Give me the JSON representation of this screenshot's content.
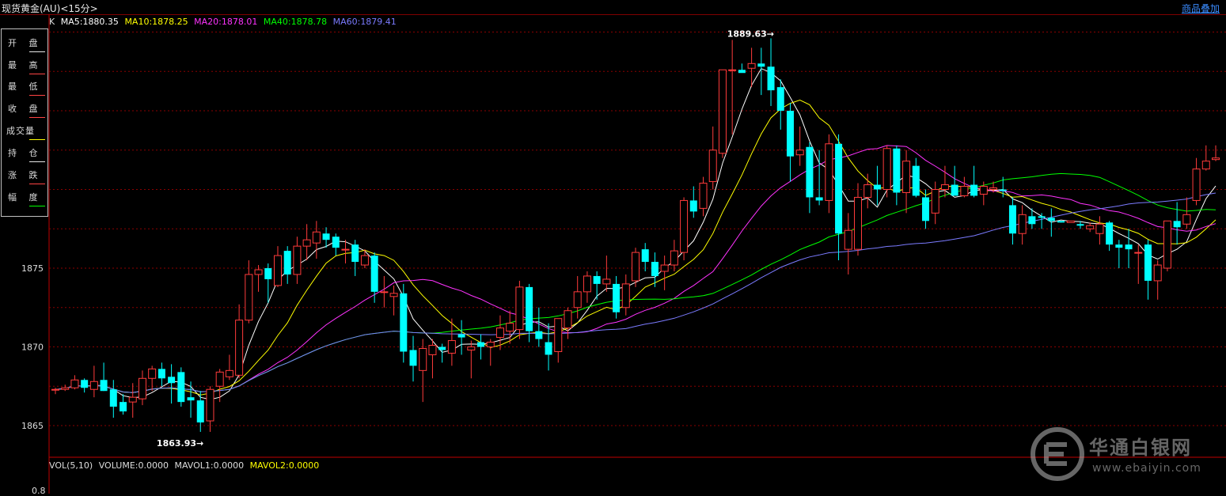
{
  "header": {
    "title": "现货黄金(AU)<15分>",
    "overlay_link": "商品叠加"
  },
  "ma_legend": {
    "prefix": "K",
    "items": [
      {
        "label": "MA5:1880.35",
        "color": "#ffffff"
      },
      {
        "label": "MA10:1878.25",
        "color": "#ffff00"
      },
      {
        "label": "MA20:1878.01",
        "color": "#ff33ff"
      },
      {
        "label": "MA40:1878.78",
        "color": "#00ff00"
      },
      {
        "label": "MA60:1879.41",
        "color": "#7b7bff"
      }
    ]
  },
  "info_panel": {
    "rows": [
      "开 盘",
      "最 高",
      "最 低",
      "收 盘",
      "成交量",
      "持 仓",
      "涨 跌",
      "幅 度"
    ]
  },
  "annotations": {
    "high": "1889.63→",
    "low": "1863.93→"
  },
  "volume_legend": {
    "items": [
      {
        "label": "VOL(5,10)",
        "color": "#dddddd"
      },
      {
        "label": "VOLUME:0.0000",
        "color": "#dddddd"
      },
      {
        "label": "MAVOL1:0.0000",
        "color": "#dddddd"
      },
      {
        "label": "MAVOL2:0.0000",
        "color": "#ffff00"
      }
    ],
    "tick": "0.8"
  },
  "watermark": {
    "text": "华通白银网",
    "url": "www.ebaiyin.com"
  },
  "colors": {
    "up": "#ff3b3b",
    "down": "#00ffff",
    "grid": "#8b0000"
  },
  "chart_data": {
    "type": "candlestick",
    "title": "",
    "ylim": [
      1862,
      1892
    ],
    "yticks": [
      1865,
      1870,
      1875
    ],
    "candles": [
      [
        1867.3,
        1867.4,
        1867.0,
        1867.3
      ],
      [
        1867.3,
        1867.6,
        1867.2,
        1867.4
      ],
      [
        1867.4,
        1868.2,
        1867.3,
        1867.9
      ],
      [
        1867.9,
        1868.0,
        1867.1,
        1867.4
      ],
      [
        1867.3,
        1868.8,
        1866.8,
        1867.8
      ],
      [
        1867.9,
        1869.0,
        1867.2,
        1867.2
      ],
      [
        1867.3,
        1867.9,
        1865.5,
        1866.2
      ],
      [
        1866.5,
        1867.0,
        1865.7,
        1865.9
      ],
      [
        1866.5,
        1867.7,
        1865.5,
        1866.8
      ],
      [
        1866.7,
        1868.5,
        1866.3,
        1868.0
      ],
      [
        1868.0,
        1868.8,
        1867.2,
        1868.6
      ],
      [
        1868.6,
        1869.0,
        1867.5,
        1868.0
      ],
      [
        1868.1,
        1868.9,
        1866.4,
        1867.7
      ],
      [
        1868.4,
        1868.7,
        1866.2,
        1866.5
      ],
      [
        1866.8,
        1867.8,
        1865.5,
        1866.6
      ],
      [
        1866.6,
        1867.2,
        1864.6,
        1865.2
      ],
      [
        1865.3,
        1867.5,
        1864.6,
        1867.3
      ],
      [
        1867.5,
        1868.6,
        1866.5,
        1868.4
      ],
      [
        1868.1,
        1869.5,
        1867.9,
        1868.5
      ],
      [
        1868.2,
        1872.7,
        1868.0,
        1871.7
      ],
      [
        1871.7,
        1875.5,
        1871.5,
        1874.6
      ],
      [
        1874.6,
        1875.2,
        1873.5,
        1874.9
      ],
      [
        1875.0,
        1875.3,
        1872.8,
        1874.3
      ],
      [
        1873.9,
        1876.4,
        1873.8,
        1875.8
      ],
      [
        1876.1,
        1876.4,
        1874.0,
        1874.6
      ],
      [
        1874.6,
        1877.0,
        1874.0,
        1876.4
      ],
      [
        1876.4,
        1877.8,
        1875.5,
        1876.8
      ],
      [
        1876.6,
        1878.0,
        1875.6,
        1877.3
      ],
      [
        1877.2,
        1877.6,
        1876.3,
        1876.8
      ],
      [
        1877.0,
        1877.2,
        1875.8,
        1876.3
      ],
      [
        1876.2,
        1876.8,
        1875.3,
        1876.2
      ],
      [
        1876.5,
        1876.8,
        1874.5,
        1875.4
      ],
      [
        1875.2,
        1876.2,
        1875.0,
        1875.8
      ],
      [
        1875.8,
        1876.0,
        1872.8,
        1873.5
      ],
      [
        1873.5,
        1874.5,
        1872.5,
        1873.5
      ],
      [
        1873.2,
        1873.9,
        1872.0,
        1873.4
      ],
      [
        1873.4,
        1874.0,
        1869.0,
        1869.7
      ],
      [
        1869.8,
        1870.7,
        1867.8,
        1868.8
      ],
      [
        1868.5,
        1870.5,
        1866.5,
        1869.9
      ],
      [
        1869.5,
        1870.5,
        1868.0,
        1870.1
      ],
      [
        1870.0,
        1870.2,
        1869.0,
        1869.8
      ],
      [
        1869.6,
        1871.8,
        1868.8,
        1870.4
      ],
      [
        1870.8,
        1871.7,
        1869.5,
        1870.6
      ],
      [
        1869.8,
        1870.4,
        1868.0,
        1870.0
      ],
      [
        1870.3,
        1870.8,
        1869.2,
        1870.0
      ],
      [
        1870.0,
        1870.5,
        1868.8,
        1870.3
      ],
      [
        1870.6,
        1872.0,
        1869.8,
        1871.2
      ],
      [
        1871.0,
        1872.3,
        1870.2,
        1871.5
      ],
      [
        1871.1,
        1874.2,
        1870.5,
        1873.8
      ],
      [
        1873.8,
        1874.0,
        1870.3,
        1871.0
      ],
      [
        1871.0,
        1872.5,
        1870.0,
        1870.5
      ],
      [
        1870.3,
        1871.5,
        1868.5,
        1869.5
      ],
      [
        1869.7,
        1871.5,
        1869.0,
        1871.8
      ],
      [
        1871.2,
        1872.5,
        1870.5,
        1872.3
      ],
      [
        1872.5,
        1874.5,
        1871.8,
        1873.5
      ],
      [
        1873.5,
        1874.8,
        1872.8,
        1874.5
      ],
      [
        1874.5,
        1874.8,
        1873.0,
        1874.0
      ],
      [
        1874.0,
        1875.8,
        1873.5,
        1874.3
      ],
      [
        1874.0,
        1874.5,
        1871.8,
        1872.2
      ],
      [
        1872.5,
        1874.6,
        1872.0,
        1874.0
      ],
      [
        1874.2,
        1876.3,
        1873.8,
        1876.0
      ],
      [
        1876.2,
        1876.6,
        1874.8,
        1875.4
      ],
      [
        1875.4,
        1876.0,
        1873.8,
        1874.5
      ],
      [
        1874.8,
        1875.8,
        1873.6,
        1875.2
      ],
      [
        1875.2,
        1876.8,
        1874.8,
        1876.1
      ],
      [
        1876.0,
        1879.5,
        1875.5,
        1879.3
      ],
      [
        1879.3,
        1880.2,
        1878.2,
        1878.6
      ],
      [
        1878.8,
        1880.8,
        1878.3,
        1880.4
      ],
      [
        1880.5,
        1884.0,
        1880.0,
        1882.5
      ],
      [
        1882.3,
        1886.0,
        1882.0,
        1887.6
      ],
      [
        1887.6,
        1889.5,
        1883.5,
        1887.6
      ],
      [
        1887.6,
        1888.0,
        1887.5,
        1887.4
      ],
      [
        1887.7,
        1889.0,
        1886.5,
        1888.0
      ],
      [
        1888.0,
        1889.0,
        1886.0,
        1887.8
      ],
      [
        1887.8,
        1889.6,
        1885.3,
        1886.3
      ],
      [
        1886.5,
        1887.0,
        1883.8,
        1885.0
      ],
      [
        1885.0,
        1885.5,
        1880.5,
        1882.1
      ],
      [
        1882.2,
        1884.0,
        1881.5,
        1882.5
      ],
      [
        1882.7,
        1883.0,
        1878.5,
        1879.5
      ],
      [
        1879.5,
        1882.5,
        1879.0,
        1879.3
      ],
      [
        1879.3,
        1883.5,
        1878.5,
        1882.9
      ],
      [
        1882.9,
        1883.5,
        1875.5,
        1877.2
      ],
      [
        1876.2,
        1878.5,
        1874.6,
        1877.4
      ],
      [
        1876.2,
        1880.4,
        1875.8,
        1879.5
      ],
      [
        1879.5,
        1881.0,
        1878.8,
        1880.3
      ],
      [
        1880.3,
        1881.5,
        1879.0,
        1880.0
      ],
      [
        1880.0,
        1882.8,
        1879.5,
        1882.6
      ],
      [
        1882.6,
        1882.8,
        1879.0,
        1879.8
      ],
      [
        1879.8,
        1882.5,
        1878.5,
        1881.8
      ],
      [
        1881.5,
        1882.0,
        1879.5,
        1879.6
      ],
      [
        1879.5,
        1880.0,
        1877.5,
        1878.0
      ],
      [
        1878.5,
        1880.5,
        1877.8,
        1880.0
      ],
      [
        1880.0,
        1881.5,
        1879.5,
        1880.3
      ],
      [
        1880.3,
        1881.5,
        1879.7,
        1879.6
      ],
      [
        1879.6,
        1880.8,
        1879.5,
        1880.2
      ],
      [
        1880.3,
        1881.5,
        1879.5,
        1879.6
      ],
      [
        1879.7,
        1880.5,
        1879.0,
        1880.2
      ],
      [
        1880.0,
        1880.5,
        1879.8,
        1880.1
      ],
      [
        1880.0,
        1880.8,
        1879.5,
        1879.9
      ],
      [
        1879.0,
        1879.5,
        1876.5,
        1877.2
      ],
      [
        1877.2,
        1879.0,
        1876.5,
        1878.4
      ],
      [
        1878.3,
        1878.8,
        1877.5,
        1877.8
      ],
      [
        1878.3,
        1878.5,
        1877.5,
        1878.2
      ],
      [
        1878.2,
        1878.8,
        1877.0,
        1878.0
      ],
      [
        1878.0,
        1878.0,
        1877.9,
        1877.9
      ],
      [
        1877.9,
        1878.0,
        1877.9,
        1878.0
      ],
      [
        1877.8,
        1878.0,
        1877.5,
        1877.7
      ],
      [
        1877.5,
        1877.9,
        1877.3,
        1877.7
      ],
      [
        1877.2,
        1878.3,
        1876.5,
        1877.8
      ],
      [
        1877.9,
        1878.0,
        1876.1,
        1876.5
      ],
      [
        1876.5,
        1876.8,
        1875.0,
        1876.3
      ],
      [
        1876.5,
        1877.5,
        1875.0,
        1876.2
      ],
      [
        1876.0,
        1876.5,
        1874.0,
        1876.0
      ],
      [
        1876.5,
        1876.8,
        1873.0,
        1874.2
      ],
      [
        1874.2,
        1875.5,
        1873.0,
        1875.2
      ],
      [
        1875.0,
        1878.0,
        1874.8,
        1878.0
      ],
      [
        1878.0,
        1879.2,
        1876.5,
        1877.6
      ],
      [
        1877.8,
        1879.5,
        1877.5,
        1878.4
      ],
      [
        1879.3,
        1882.0,
        1879.0,
        1881.3
      ],
      [
        1881.3,
        1882.8,
        1881.2,
        1881.8
      ],
      [
        1881.9,
        1882.8,
        1881.8,
        1882.0
      ]
    ],
    "ma_series": [
      {
        "name": "MA5",
        "color": "#ffffff",
        "window": 5
      },
      {
        "name": "MA10",
        "color": "#ffff00",
        "window": 10
      },
      {
        "name": "MA20",
        "color": "#ff33ff",
        "window": 20
      },
      {
        "name": "MA40",
        "color": "#00ff00",
        "window": 40
      },
      {
        "name": "MA60",
        "color": "#7b7bff",
        "window": 60
      }
    ]
  }
}
